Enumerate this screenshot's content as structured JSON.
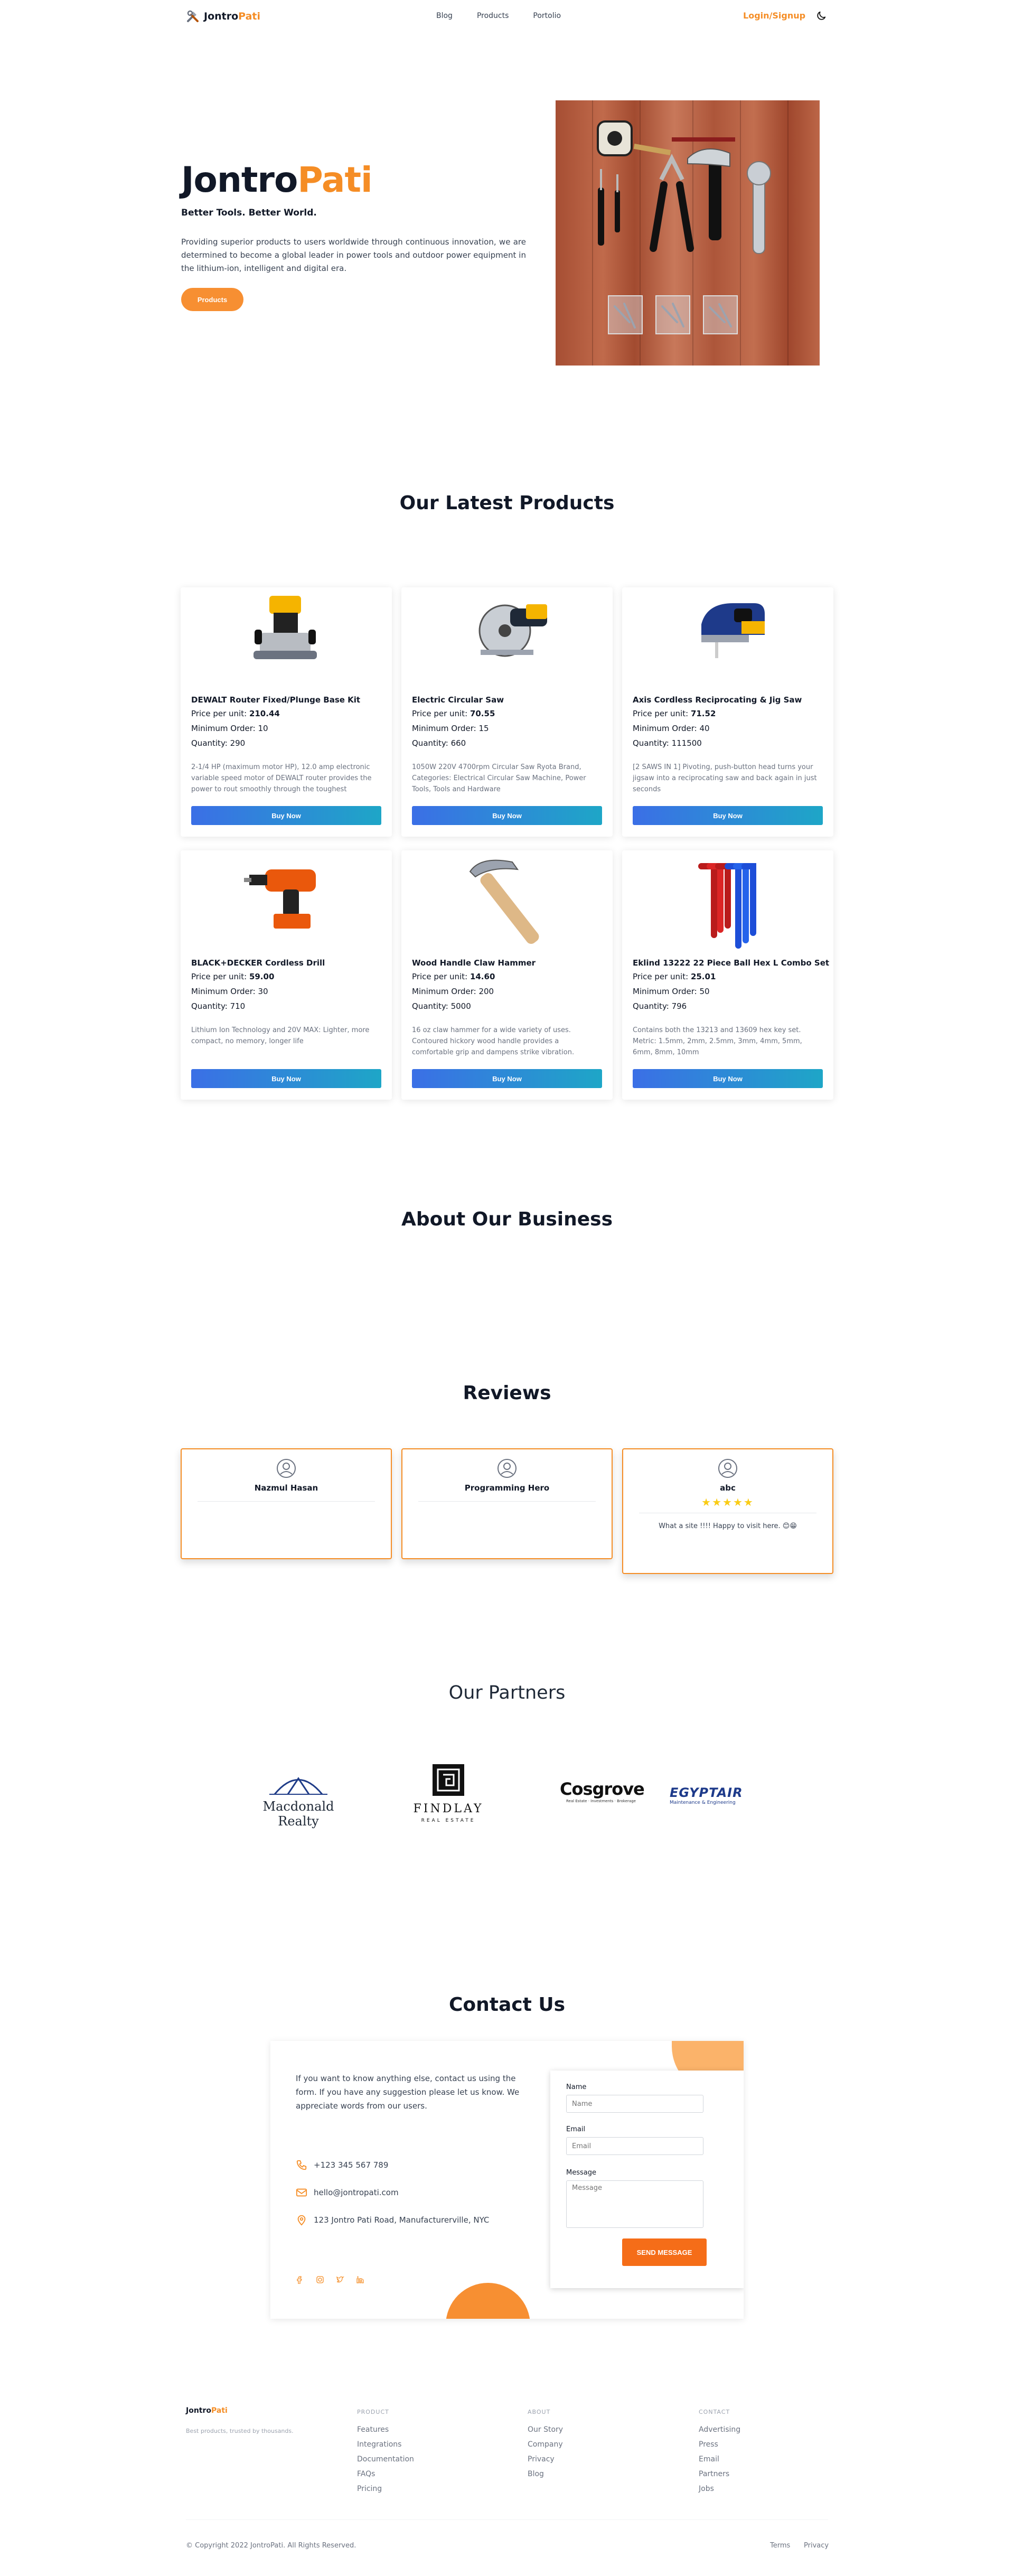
{
  "brand": {
    "part1": "Jontro",
    "part2": "Pati"
  },
  "nav": {
    "links": [
      "Blog",
      "Products",
      "Portolio"
    ],
    "login": "Login/Signup"
  },
  "hero": {
    "title1": "Jontro",
    "title2": "Pati",
    "subtitle": "Better Tools. Better World.",
    "text": "Providing superior products to users worldwide through continuous innovation, we are determined to become a global leader in power tools and outdoor power equipment in the lithium-ion, intelligent and digital era.",
    "button": "Products"
  },
  "products_section": {
    "title": "Our Latest Products",
    "price_label": "Price per unit: ",
    "min_label": "Minimum Order: ",
    "qty_label": "Quantity: ",
    "buy_label": "Buy Now",
    "items": [
      {
        "name": "DEWALT Router Fixed/Plunge Base Kit",
        "price": "210.44",
        "min": "10",
        "qty": "290",
        "desc": "2-1/4 HP (maximum motor HP), 12.0 amp electronic variable speed motor of DEWALT router provides the power to rout smoothly through the toughest"
      },
      {
        "name": "Electric Circular Saw",
        "price": "70.55",
        "min": "15",
        "qty": "660",
        "desc": "1050W 220V 4700rpm Circular Saw Ryota Brand, Categories: Electrical Circular Saw Machine, Power Tools, Tools and Hardware"
      },
      {
        "name": "Axis Cordless Reciprocating & Jig Saw",
        "price": "71.52",
        "min": "40",
        "qty": "111500",
        "desc": "[2 SAWS IN 1] Pivoting, push-button head turns your jigsaw into a reciprocating saw and back again in just seconds"
      },
      {
        "name": "BLACK+DECKER Cordless Drill",
        "price": "59.00",
        "min": "30",
        "qty": "710",
        "desc": "Lithium Ion Technology and 20V MAX: Lighter, more compact, no memory, longer life"
      },
      {
        "name": "Wood Handle Claw Hammer",
        "price": "14.60",
        "min": "200",
        "qty": "5000",
        "desc": "16 oz claw hammer for a wide variety of uses. Contoured hickory wood handle provides a comfortable grip and dampens strike vibration."
      },
      {
        "name": "Eklind 13222 22 Piece Ball Hex L Combo Set",
        "price": "25.01",
        "min": "50",
        "qty": "796",
        "desc": "Contains both the 13213 and 13609 hex key set. Metric: 1.5mm, 2mm, 2.5mm, 3mm, 4mm, 5mm, 6mm, 8mm, 10mm"
      }
    ]
  },
  "about": {
    "title": "About Our Business"
  },
  "reviews": {
    "title": "Reviews",
    "items": [
      {
        "name": "Nazmul Hasan",
        "stars": "",
        "text": ""
      },
      {
        "name": "Programming Hero",
        "stars": "",
        "text": ""
      },
      {
        "name": "abc",
        "stars": "★★★★★",
        "text": "What a site !!!! Happy to visit here. 😊😁"
      }
    ]
  },
  "partners": {
    "title": "Our Partners",
    "logos": [
      {
        "line1": "Macdonald",
        "line2": "Realty"
      },
      {
        "line1": "FINDLAY",
        "line2": "REAL ESTATE"
      },
      {
        "line1": "Cosgrove",
        "line2": "Real Estate · Investments · Brokerage"
      },
      {
        "line1": "EGYPTAIR",
        "line2": "Maintenance & Engineering"
      }
    ]
  },
  "contact": {
    "title": "Contact Us",
    "text": "If you want to know anything else, contact us using the form. If you have any suggestion please let us know. We appreciate words from our users.",
    "phone": "+123 345 567 789",
    "email": "hello@jontropati.com",
    "address": "123 Jontro Pati Road, Manufacturerville, NYC",
    "form": {
      "name_label": "Name",
      "name_ph": "Name",
      "email_label": "Email",
      "email_ph": "Email",
      "message_label": "Message",
      "message_ph": "Message",
      "send": "SEND MESSAGE"
    }
  },
  "footer": {
    "tagline": "Best products, trusted by thousands.",
    "product_head": "PRODUCT",
    "product_links": [
      "Features",
      "Integrations",
      "Documentation",
      "FAQs",
      "Pricing"
    ],
    "about_head": "ABOUT",
    "about_links": [
      "Our Story",
      "Company",
      "Privacy",
      "Blog"
    ],
    "contact_head": "CONTACT",
    "contact_links": [
      "Advertising",
      "Press",
      "Email",
      "Partners",
      "Jobs"
    ],
    "copyright": "© Copyright 2022 JontroPati. All Rights Reserved.",
    "terms": "Terms",
    "privacy": "Privacy"
  },
  "colors": {
    "accent": "#f58d25",
    "buy_start": "#3b6fe6",
    "buy_end": "#1ea6c7",
    "send": "#f56d18"
  }
}
